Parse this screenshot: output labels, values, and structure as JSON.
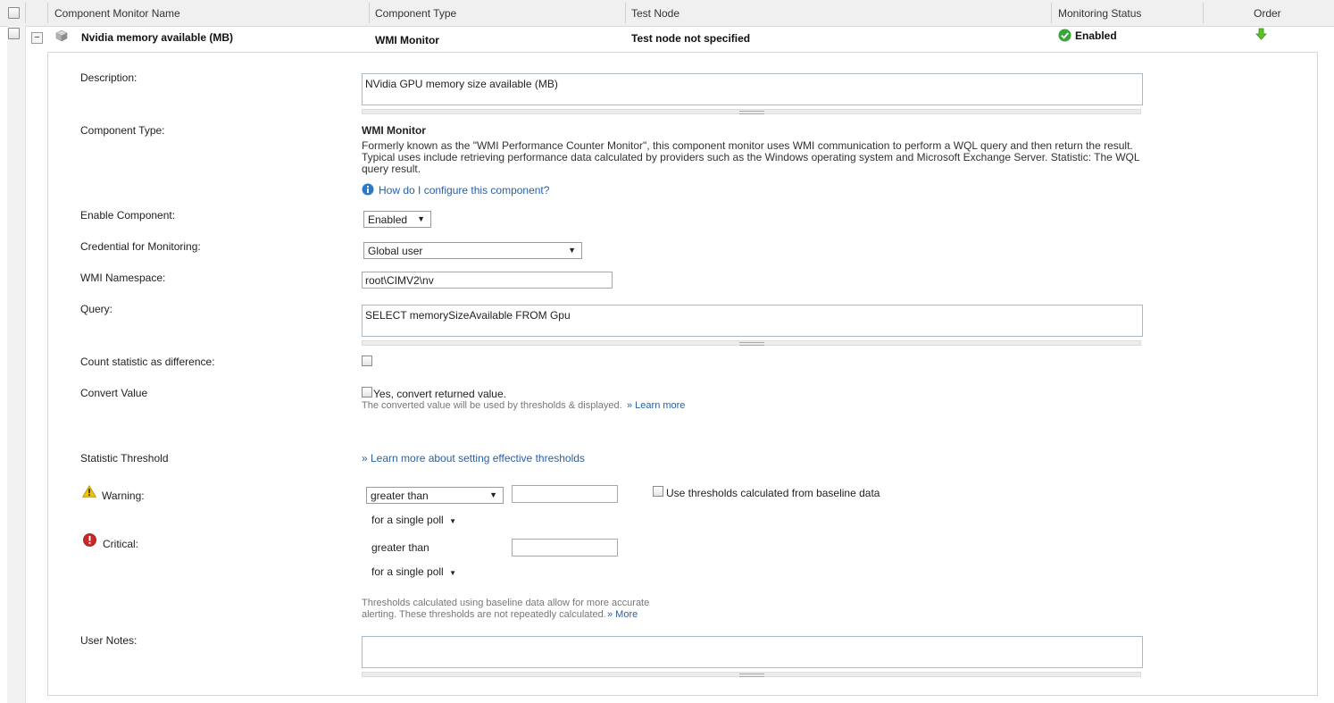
{
  "header": {
    "col_name": "Component Monitor Name",
    "col_type": "Component Type",
    "col_node": "Test Node",
    "col_status": "Monitoring Status",
    "col_order": "Order"
  },
  "row": {
    "collapse_glyph": "−",
    "name": "Nvidia memory available (MB)",
    "type": "WMI Monitor",
    "test_node": "Test node not specified",
    "status": "Enabled"
  },
  "form": {
    "description_label": "Description:",
    "description_value": "NVidia GPU memory size available (MB)",
    "component_type_label": "Component Type:",
    "component_type_title": "WMI Monitor",
    "component_type_desc": "Formerly known as the \"WMI Performance Counter Monitor\", this component monitor uses WMI communication to perform a WQL query and then return the result. Typical uses include retrieving performance data calculated by providers such as the Windows operating system and Microsoft Exchange Server. Statistic: The WQL query result.",
    "configure_link": "How do I configure this component?",
    "enable_label": "Enable Component:",
    "enable_value": "Enabled",
    "credential_label": "Credential for Monitoring:",
    "credential_value": "Global user",
    "namespace_label": "WMI Namespace:",
    "namespace_value": "root\\CIMV2\\nv",
    "query_label": "Query:",
    "query_value": "SELECT memorySizeAvailable FROM Gpu",
    "count_label": "Count statistic as difference:",
    "convert_label": "Convert Value",
    "convert_checkbox": "Yes, convert returned value.",
    "convert_note": "The converted value will be used by thresholds & displayed.",
    "convert_learn": "» Learn more",
    "threshold_label": "Statistic Threshold",
    "threshold_link": "» Learn more about setting effective thresholds",
    "warning_label": "Warning:",
    "warning_operator": "greater than",
    "warning_value": "",
    "baseline_label": "Use thresholds calculated from baseline data",
    "warning_poll": "for  a single poll",
    "critical_label": "Critical:",
    "critical_operator": "greater than",
    "critical_value": "",
    "critical_poll": "for  a single poll",
    "baseline_note_1": "Thresholds calculated using baseline data allow for more accurate",
    "baseline_note_2": "alerting. These thresholds are not repeatedly calculated.",
    "baseline_more": "» More",
    "notes_label": "User Notes:",
    "notes_value": ""
  },
  "icons": {
    "status": "check-circle-icon",
    "order": "arrow-down-icon",
    "component": "cube-icon",
    "info": "info-icon",
    "warning": "warning-triangle-icon",
    "critical": "critical-circle-icon"
  },
  "colors": {
    "link": "#2b5fa0",
    "enabled_green": "#3aa53a",
    "warning_yellow": "#f2c200",
    "critical_red": "#c8282a"
  }
}
